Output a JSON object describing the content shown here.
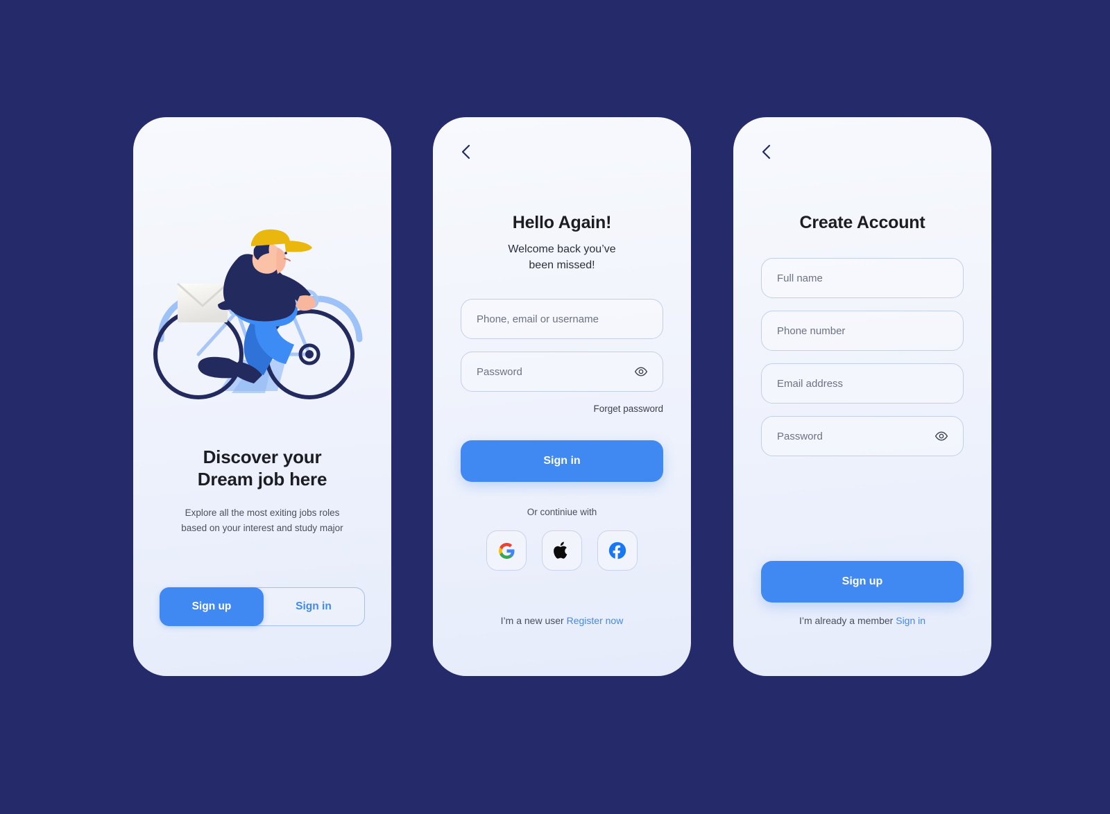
{
  "theme": {
    "background": "#242a6a",
    "card_top": "#f7f9fd",
    "card_bottom": "#e6ecfb",
    "accent_blue": "#4189f2",
    "text_dark": "#1c1c23",
    "text_muted": "#4b4e5a",
    "field_border": "#c3cfe9",
    "illustration_navy": "#232a5e",
    "illustration_blue": "#3d8bf5",
    "illustration_light_blue": "#9dc2f7",
    "illustration_yellow": "#e9b70d",
    "illustration_skin": "#f8b79c"
  },
  "screens": {
    "onboarding": {
      "name": "onboarding",
      "illustration_alt": "cyclist-delivering-mail",
      "title_line1": "Discover your",
      "title_line2": "Dream job here",
      "subtitle_line1": "Explore all the most exiting jobs roles",
      "subtitle_line2": "based on your interest and study major",
      "toggle": {
        "active_label": "Sign up",
        "inactive_label": "Sign in"
      }
    },
    "signin": {
      "name": "sign-in",
      "back_icon": "chevron-left-icon",
      "title": "Hello Again!",
      "subtitle_line1": "Welcome back you’ve",
      "subtitle_line2": "been missed!",
      "fields": [
        {
          "name": "identifier",
          "placeholder": "Phone, email or username",
          "value": "",
          "has_eye": false
        },
        {
          "name": "password",
          "placeholder": "Password",
          "value": "",
          "has_eye": true,
          "eye_icon": "eye-icon"
        }
      ],
      "forget_password": "Forget password",
      "submit_label": "Sign in",
      "divider_label": "Or continiue with",
      "social": [
        {
          "name": "google",
          "icon": "google-icon"
        },
        {
          "name": "apple",
          "icon": "apple-icon"
        },
        {
          "name": "facebook",
          "icon": "facebook-icon"
        }
      ],
      "footer_text": "I’m a  new user",
      "footer_link": "Register now"
    },
    "signup": {
      "name": "create-account",
      "back_icon": "chevron-left-icon",
      "title": "Create Account",
      "fields": [
        {
          "name": "full-name",
          "placeholder": "Full name",
          "value": "",
          "has_eye": false
        },
        {
          "name": "phone-number",
          "placeholder": "Phone number",
          "value": "",
          "has_eye": false
        },
        {
          "name": "email-address",
          "placeholder": "Email address",
          "value": "",
          "has_eye": false
        },
        {
          "name": "password",
          "placeholder": "Password",
          "value": "",
          "has_eye": true,
          "eye_icon": "eye-icon"
        }
      ],
      "submit_label": "Sign up",
      "footer_text": "I’m already a member",
      "footer_link": "Sign in"
    }
  }
}
